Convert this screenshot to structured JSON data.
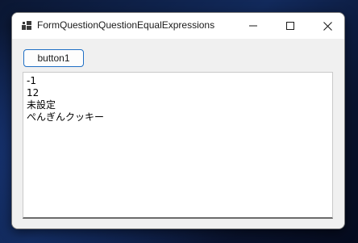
{
  "window": {
    "title": "FormQuestionQuestionEqualExpressions"
  },
  "titlebar": {
    "icons": [
      "app-icon",
      "minimize-icon",
      "maximize-icon",
      "close-icon"
    ]
  },
  "form": {
    "button1_label": "button1",
    "output_lines": [
      "-1",
      "12",
      "未設定",
      "ぺんぎんクッキー"
    ]
  },
  "colors": {
    "button_border": "#1f6fc5",
    "window_bg": "#f0f0f0",
    "titlebar_bg": "#ffffff"
  }
}
